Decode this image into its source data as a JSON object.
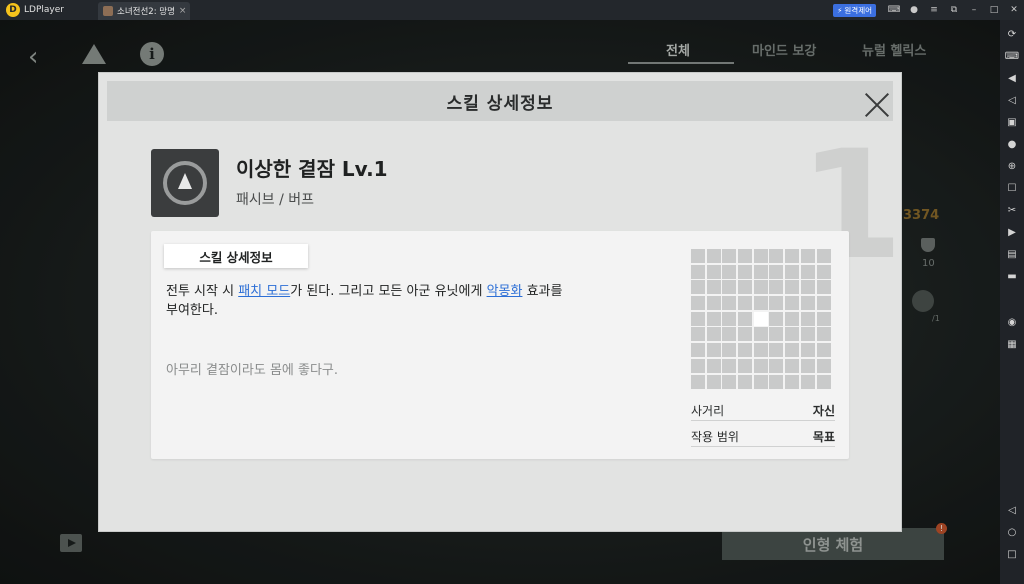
{
  "titlebar": {
    "app_name": "LDPlayer",
    "logo_glyph": "D",
    "tab_label": "소녀전선2: 망명",
    "tab_close": "×",
    "remote_label": "원격제어",
    "icons": [
      "gamepad-icon",
      "account-icon",
      "menu-icon",
      "restore-small-icon",
      "minimize-icon",
      "maximize-icon",
      "close-icon"
    ]
  },
  "sidebar": {
    "icons": [
      "sync-icon",
      "keyboard-icon",
      "volume-up-icon",
      "volume-down-icon",
      "screen-icon",
      "lock-icon",
      "add-icon",
      "robot-icon",
      "scissors-icon",
      "record-icon",
      "apk-icon",
      "folder-icon",
      "location-icon",
      "multi-icon",
      "back-icon",
      "home-icon",
      "recents-icon"
    ]
  },
  "game": {
    "tabs": {
      "all": "전체",
      "mind": "마인드 보강",
      "neural": "뉴럴 헬릭스"
    },
    "side_number": "3374",
    "side_ten": "10",
    "side_slash": "/1",
    "experience_button": "인형 체험",
    "badge": "!"
  },
  "modal": {
    "title": "스킬 상세정보",
    "bg_number": "1",
    "skill": {
      "name": "이상한 곁잠 Lv.1",
      "type": "패시브 / 버프"
    },
    "panel_tab": "스킬 상세정보",
    "description": {
      "part1": "전투 시작 시 ",
      "kw1": "패치 모드",
      "part2": "가 된다. 그리고 모든 아군 유닛에게 ",
      "kw2": "악몽화",
      "part3": " 효과를",
      "line2": "부여한다."
    },
    "flavor": "아무리 곁잠이라도 몸에 좋다구.",
    "range_grid": {
      "rows": 9,
      "cols": 9,
      "self_cell": [
        4,
        4
      ]
    },
    "stats": [
      {
        "label": "사거리",
        "value": "자신"
      },
      {
        "label": "작용 범위",
        "value": "목표"
      }
    ]
  }
}
